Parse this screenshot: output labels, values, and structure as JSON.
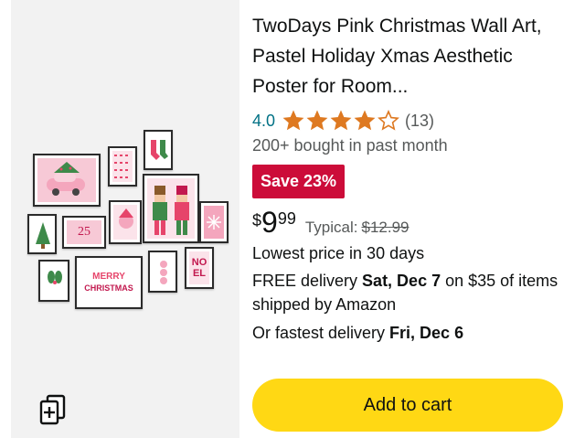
{
  "product": {
    "title": "TwoDays Pink Christmas Wall Art, Pastel Holiday Xmas Aesthetic Poster for Room...",
    "rating_value": "4.0",
    "rating_stars": 4,
    "rating_count": "(13)",
    "bought_text": "200+ bought in past month",
    "save_badge": "Save 23%",
    "price": {
      "symbol": "$",
      "whole": "9",
      "fraction": "99"
    },
    "typical_label": "Typical:",
    "typical_price": "$12.99",
    "lowest_price_text": "Lowest price in 30 days",
    "delivery": {
      "prefix": "FREE delivery ",
      "date": "Sat, Dec 7",
      "suffix": " on $35 of items shipped by Amazon"
    },
    "fastest": {
      "prefix": "Or fastest delivery ",
      "date": "Fri, Dec 6"
    },
    "add_to_cart_label": "Add to cart"
  },
  "image": {
    "poster_text": {
      "date_label": "25",
      "merry": "MERRY",
      "christmas": "CHRISTMAS",
      "noel_1": "NO",
      "noel_2": "EL"
    }
  },
  "icons": {
    "compare": "compare-cards-icon",
    "star": "star-icon"
  },
  "colors": {
    "link_teal": "#007185",
    "star_orange": "#de7921",
    "save_red": "#cc0c39",
    "cart_yellow": "#ffd814",
    "poster_pink": "#f7c9d6"
  }
}
